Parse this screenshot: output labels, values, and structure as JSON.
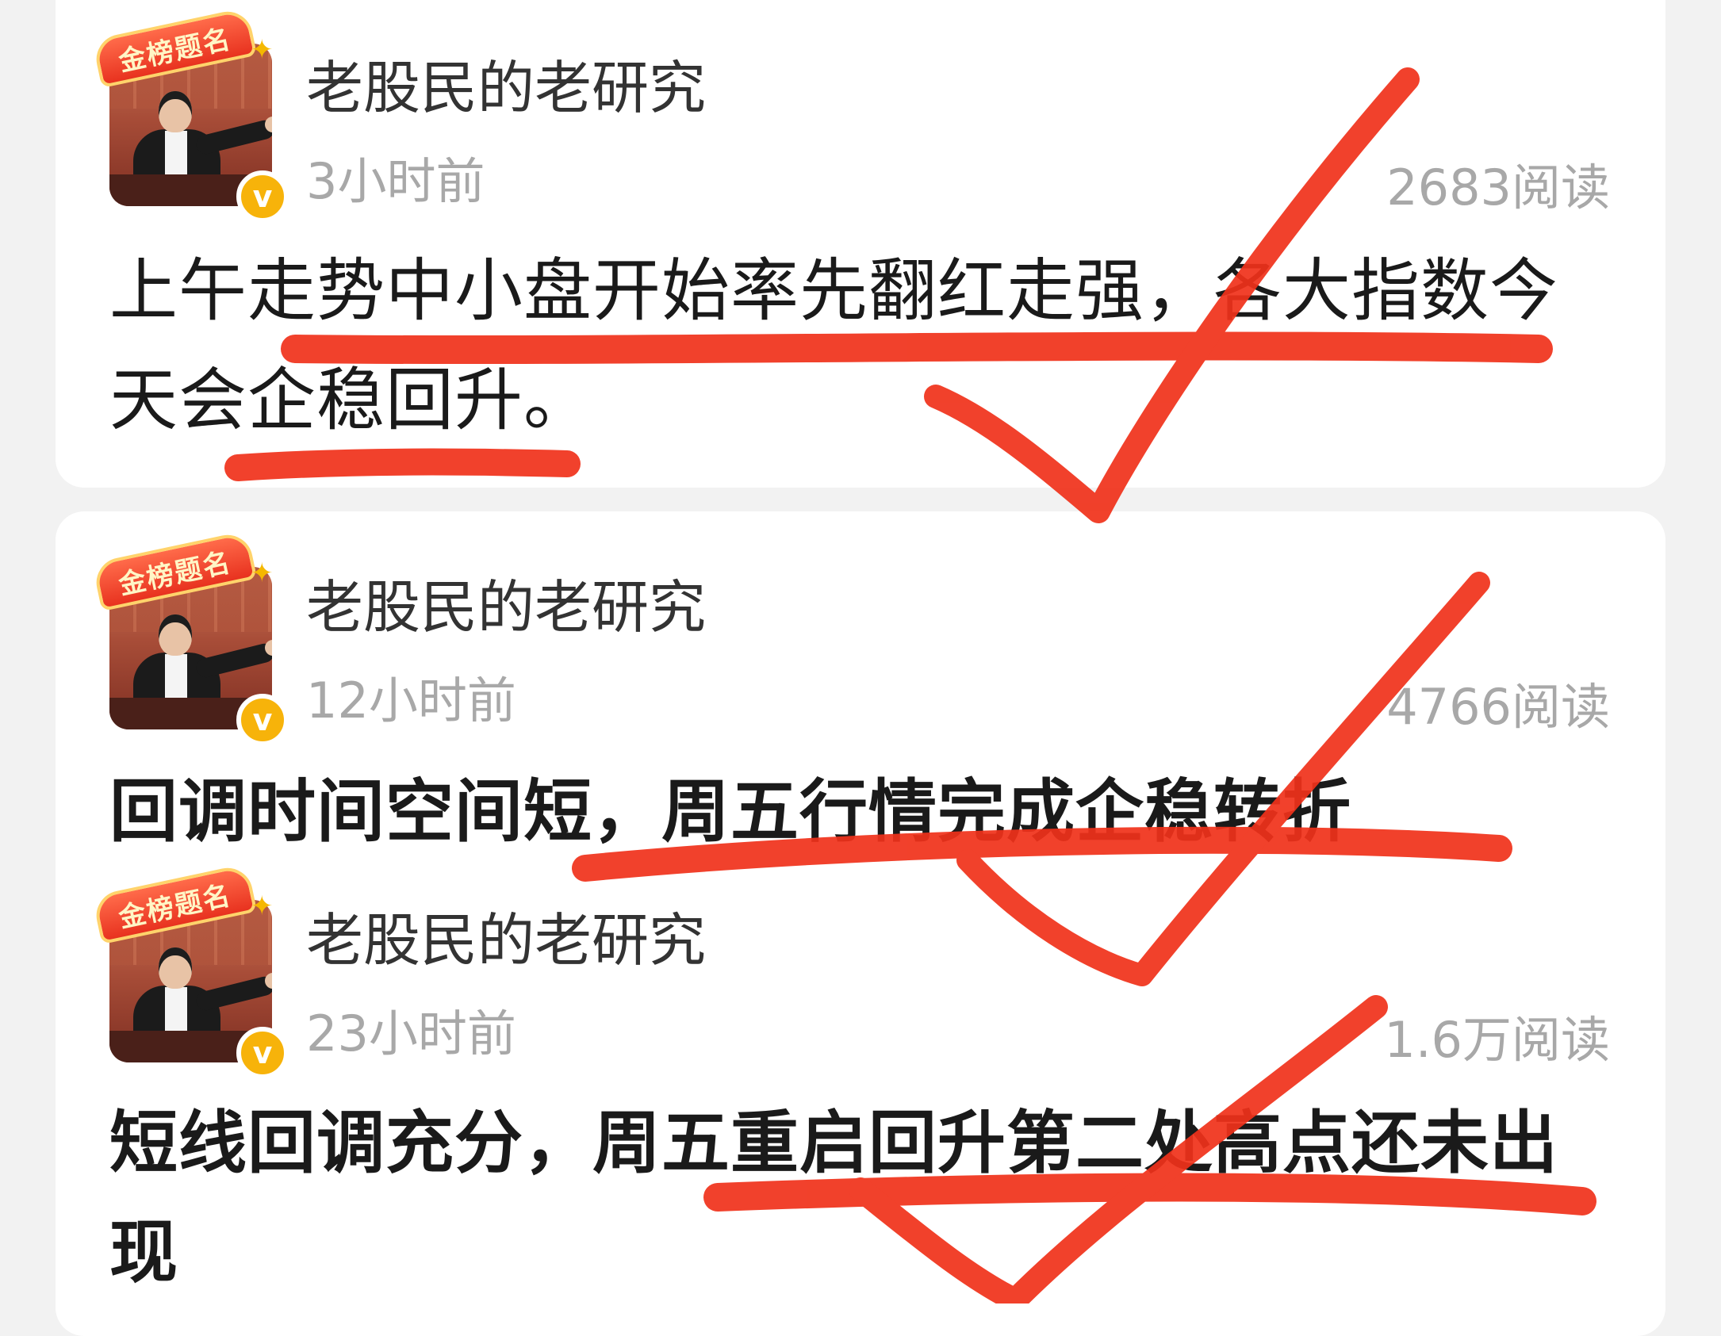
{
  "feed": {
    "posts": [
      {
        "author": "老股民的老研究",
        "time": "3小时前",
        "reads": "2683阅读",
        "content": "上午走势中小盘开始率先翻红走强，各大指数今天会企稳回升。",
        "avatar_badge": "金榜题名",
        "verified_icon": "verified-icon"
      },
      {
        "author": "老股民的老研究",
        "time": "12小时前",
        "reads": "4766阅读",
        "content": "回调时间空间短，周五行情完成企稳转折",
        "avatar_badge": "金榜题名",
        "verified_icon": "verified-icon"
      },
      {
        "author": "老股民的老研究",
        "time": "23小时前",
        "reads": "1.6万阅读",
        "content": "短线回调充分，周五重启回升第二处高点还未出现",
        "avatar_badge": "金榜题名",
        "verified_icon": "verified-icon"
      }
    ]
  },
  "verified_mark": "v",
  "colors": {
    "background": "#f2f2f2",
    "card": "#ffffff",
    "author_text": "#333333",
    "meta_text": "#a8a8a8",
    "content_text": "#1a1a1a",
    "verified_badge": "#f7b30a",
    "markup_red": "#f0311a"
  }
}
